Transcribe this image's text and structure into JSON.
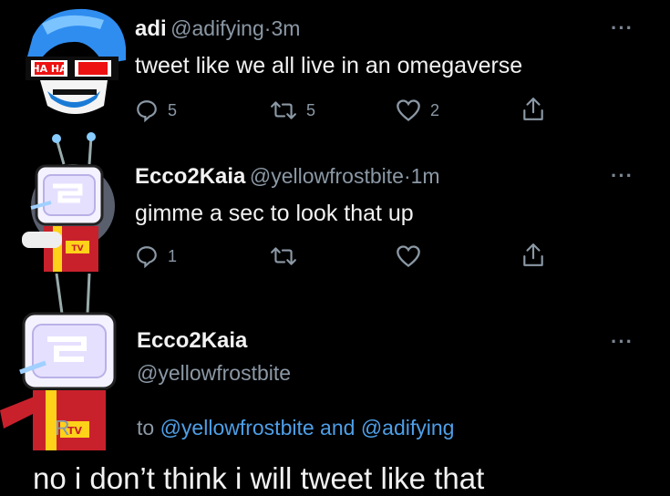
{
  "tweets": [
    {
      "name": "adi",
      "handle": "@adifying",
      "dot": "·",
      "time": "3m",
      "text": "tweet like we all live in an omegaverse",
      "replies": "5",
      "retweets": "5",
      "likes": "2",
      "avatar_text": "HA HA"
    },
    {
      "name": "Ecco2Kaia",
      "handle": "@yellowfrostbite",
      "dot": "·",
      "time": "1m",
      "text": "gimme a sec to look that up",
      "replies": "1",
      "avatar_badge": "TV"
    }
  ],
  "focused": {
    "name": "Ecco2Kaia",
    "handle": "@yellowfrostbite",
    "replying_prefix": "R",
    "replying_to": "to",
    "mention1": "@yellowfrostbite",
    "and": "and",
    "mention2": "@adifying",
    "text": "no i don’t think i will tweet like that",
    "avatar_badge": "TV"
  },
  "more_label": "···",
  "colors": {
    "background": "#000000",
    "link": "#4f9fe8",
    "muted": "#8b98a5"
  }
}
